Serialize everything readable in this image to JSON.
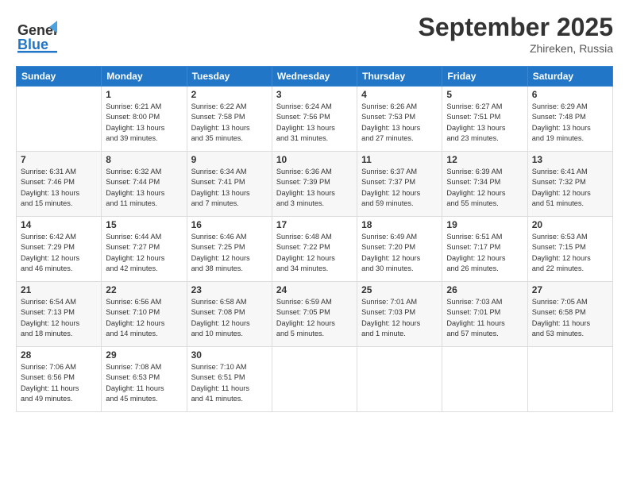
{
  "header": {
    "logo_general": "General",
    "logo_blue": "Blue",
    "month": "September 2025",
    "location": "Zhireken, Russia"
  },
  "weekdays": [
    "Sunday",
    "Monday",
    "Tuesday",
    "Wednesday",
    "Thursday",
    "Friday",
    "Saturday"
  ],
  "weeks": [
    [
      {
        "day": "",
        "info": []
      },
      {
        "day": "1",
        "info": [
          "Sunrise: 6:21 AM",
          "Sunset: 8:00 PM",
          "Daylight: 13 hours",
          "and 39 minutes."
        ]
      },
      {
        "day": "2",
        "info": [
          "Sunrise: 6:22 AM",
          "Sunset: 7:58 PM",
          "Daylight: 13 hours",
          "and 35 minutes."
        ]
      },
      {
        "day": "3",
        "info": [
          "Sunrise: 6:24 AM",
          "Sunset: 7:56 PM",
          "Daylight: 13 hours",
          "and 31 minutes."
        ]
      },
      {
        "day": "4",
        "info": [
          "Sunrise: 6:26 AM",
          "Sunset: 7:53 PM",
          "Daylight: 13 hours",
          "and 27 minutes."
        ]
      },
      {
        "day": "5",
        "info": [
          "Sunrise: 6:27 AM",
          "Sunset: 7:51 PM",
          "Daylight: 13 hours",
          "and 23 minutes."
        ]
      },
      {
        "day": "6",
        "info": [
          "Sunrise: 6:29 AM",
          "Sunset: 7:48 PM",
          "Daylight: 13 hours",
          "and 19 minutes."
        ]
      }
    ],
    [
      {
        "day": "7",
        "info": [
          "Sunrise: 6:31 AM",
          "Sunset: 7:46 PM",
          "Daylight: 13 hours",
          "and 15 minutes."
        ]
      },
      {
        "day": "8",
        "info": [
          "Sunrise: 6:32 AM",
          "Sunset: 7:44 PM",
          "Daylight: 13 hours",
          "and 11 minutes."
        ]
      },
      {
        "day": "9",
        "info": [
          "Sunrise: 6:34 AM",
          "Sunset: 7:41 PM",
          "Daylight: 13 hours",
          "and 7 minutes."
        ]
      },
      {
        "day": "10",
        "info": [
          "Sunrise: 6:36 AM",
          "Sunset: 7:39 PM",
          "Daylight: 13 hours",
          "and 3 minutes."
        ]
      },
      {
        "day": "11",
        "info": [
          "Sunrise: 6:37 AM",
          "Sunset: 7:37 PM",
          "Daylight: 12 hours",
          "and 59 minutes."
        ]
      },
      {
        "day": "12",
        "info": [
          "Sunrise: 6:39 AM",
          "Sunset: 7:34 PM",
          "Daylight: 12 hours",
          "and 55 minutes."
        ]
      },
      {
        "day": "13",
        "info": [
          "Sunrise: 6:41 AM",
          "Sunset: 7:32 PM",
          "Daylight: 12 hours",
          "and 51 minutes."
        ]
      }
    ],
    [
      {
        "day": "14",
        "info": [
          "Sunrise: 6:42 AM",
          "Sunset: 7:29 PM",
          "Daylight: 12 hours",
          "and 46 minutes."
        ]
      },
      {
        "day": "15",
        "info": [
          "Sunrise: 6:44 AM",
          "Sunset: 7:27 PM",
          "Daylight: 12 hours",
          "and 42 minutes."
        ]
      },
      {
        "day": "16",
        "info": [
          "Sunrise: 6:46 AM",
          "Sunset: 7:25 PM",
          "Daylight: 12 hours",
          "and 38 minutes."
        ]
      },
      {
        "day": "17",
        "info": [
          "Sunrise: 6:48 AM",
          "Sunset: 7:22 PM",
          "Daylight: 12 hours",
          "and 34 minutes."
        ]
      },
      {
        "day": "18",
        "info": [
          "Sunrise: 6:49 AM",
          "Sunset: 7:20 PM",
          "Daylight: 12 hours",
          "and 30 minutes."
        ]
      },
      {
        "day": "19",
        "info": [
          "Sunrise: 6:51 AM",
          "Sunset: 7:17 PM",
          "Daylight: 12 hours",
          "and 26 minutes."
        ]
      },
      {
        "day": "20",
        "info": [
          "Sunrise: 6:53 AM",
          "Sunset: 7:15 PM",
          "Daylight: 12 hours",
          "and 22 minutes."
        ]
      }
    ],
    [
      {
        "day": "21",
        "info": [
          "Sunrise: 6:54 AM",
          "Sunset: 7:13 PM",
          "Daylight: 12 hours",
          "and 18 minutes."
        ]
      },
      {
        "day": "22",
        "info": [
          "Sunrise: 6:56 AM",
          "Sunset: 7:10 PM",
          "Daylight: 12 hours",
          "and 14 minutes."
        ]
      },
      {
        "day": "23",
        "info": [
          "Sunrise: 6:58 AM",
          "Sunset: 7:08 PM",
          "Daylight: 12 hours",
          "and 10 minutes."
        ]
      },
      {
        "day": "24",
        "info": [
          "Sunrise: 6:59 AM",
          "Sunset: 7:05 PM",
          "Daylight: 12 hours",
          "and 5 minutes."
        ]
      },
      {
        "day": "25",
        "info": [
          "Sunrise: 7:01 AM",
          "Sunset: 7:03 PM",
          "Daylight: 12 hours",
          "and 1 minute."
        ]
      },
      {
        "day": "26",
        "info": [
          "Sunrise: 7:03 AM",
          "Sunset: 7:01 PM",
          "Daylight: 11 hours",
          "and 57 minutes."
        ]
      },
      {
        "day": "27",
        "info": [
          "Sunrise: 7:05 AM",
          "Sunset: 6:58 PM",
          "Daylight: 11 hours",
          "and 53 minutes."
        ]
      }
    ],
    [
      {
        "day": "28",
        "info": [
          "Sunrise: 7:06 AM",
          "Sunset: 6:56 PM",
          "Daylight: 11 hours",
          "and 49 minutes."
        ]
      },
      {
        "day": "29",
        "info": [
          "Sunrise: 7:08 AM",
          "Sunset: 6:53 PM",
          "Daylight: 11 hours",
          "and 45 minutes."
        ]
      },
      {
        "day": "30",
        "info": [
          "Sunrise: 7:10 AM",
          "Sunset: 6:51 PM",
          "Daylight: 11 hours",
          "and 41 minutes."
        ]
      },
      {
        "day": "",
        "info": []
      },
      {
        "day": "",
        "info": []
      },
      {
        "day": "",
        "info": []
      },
      {
        "day": "",
        "info": []
      }
    ]
  ]
}
